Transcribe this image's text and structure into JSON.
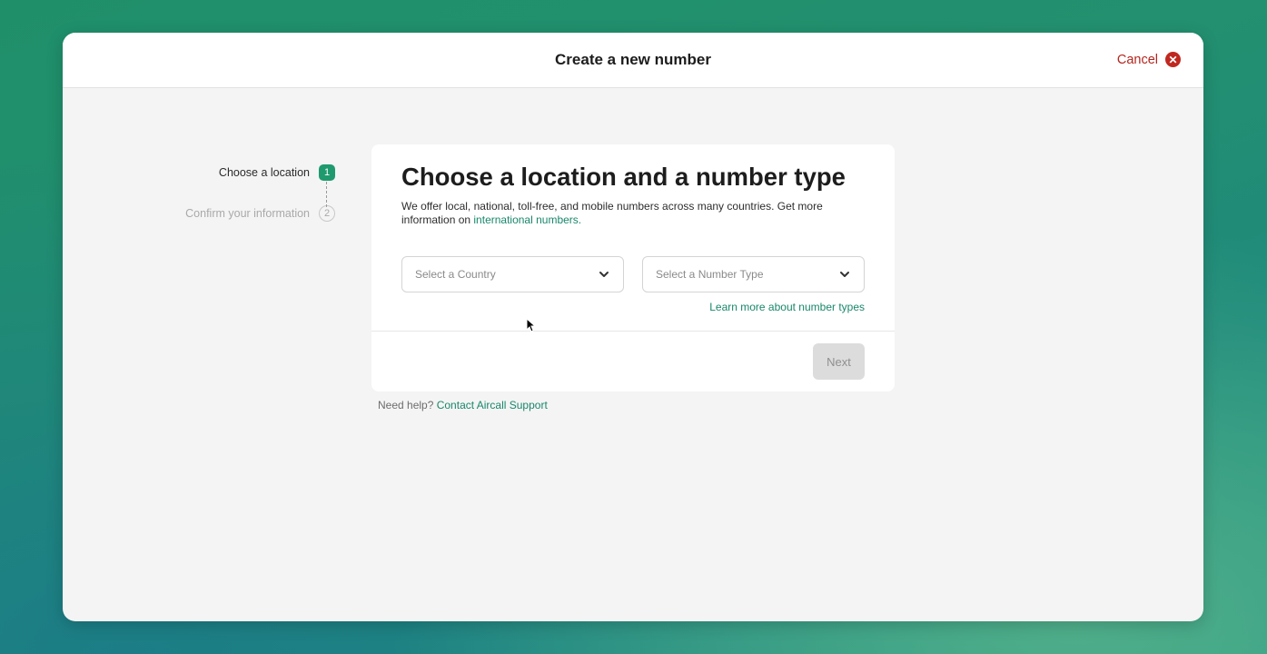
{
  "header": {
    "title": "Create a new number",
    "cancel_label": "Cancel"
  },
  "steps": [
    {
      "label": "Choose a location",
      "number": "1",
      "state": "active"
    },
    {
      "label": "Confirm your information",
      "number": "2",
      "state": "inactive"
    }
  ],
  "card": {
    "title": "Choose a location and a number type",
    "description_prefix": "We offer local, national, toll-free, and mobile numbers across many countries. Get more information on ",
    "description_link": "international numbers.",
    "country_placeholder": "Select a Country",
    "type_placeholder": "Select a Number Type",
    "learn_more": "Learn more about number types",
    "next_label": "Next"
  },
  "footer": {
    "help_prefix": "Need help? ",
    "help_link": "Contact Aircall Support"
  },
  "colors": {
    "accent": "#19876b",
    "cancel": "#b3261e"
  }
}
